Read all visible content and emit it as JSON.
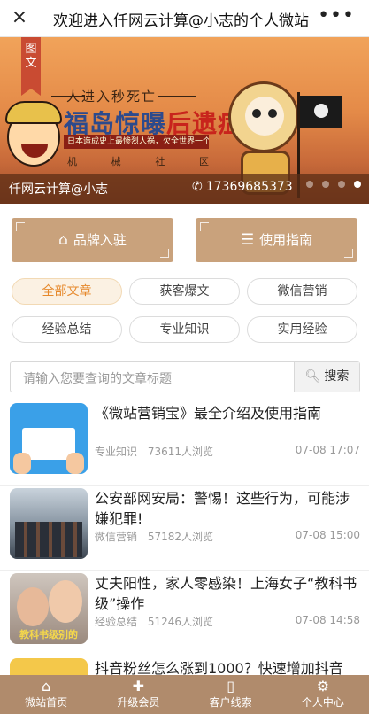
{
  "topbar": {
    "title": "欢迎进入仟网云计算@小志的个人微站",
    "close_icon": "×",
    "more_icon": "•••"
  },
  "banner": {
    "tag": "图文",
    "kicker": "人进入秒死亡",
    "headline_blue": "福岛惊曝",
    "headline_red": "后遗症",
    "strip": "日本造成史上最惨烈人祸，欠全世界一个交代!",
    "chars": [
      "机",
      "械",
      "社",
      "区"
    ],
    "site_name": "仟网云计算@小志",
    "phone": "17369685373",
    "carousel_active_index": 3,
    "carousel_count": 4
  },
  "actions": {
    "brand_label": "品牌入驻",
    "guide_label": "使用指南"
  },
  "categories": [
    "全部文章",
    "获客爆文",
    "微信营销",
    "经验总结",
    "专业知识",
    "实用经验"
  ],
  "search": {
    "placeholder": "请输入您要查询的文章标题",
    "button_label": "搜索"
  },
  "articles": [
    {
      "title": "《微站营销宝》最全介绍及使用指南",
      "category": "专业知识",
      "views": "73611人浏览",
      "time": "07-08 17:07",
      "thumb_text": ""
    },
    {
      "title": "公安部网安局：警惕！这些行为，可能涉嫌犯罪!",
      "category": "微信营销",
      "views": "57182人浏览",
      "time": "07-08 15:00",
      "thumb_text": ""
    },
    {
      "title": "丈夫阳性，家人零感染！上海女子“教科书级”操作",
      "category": "经验总结",
      "views": "51246人浏览",
      "time": "07-08 14:58",
      "thumb_text": "教科书级别的"
    },
    {
      "title": "抖音粉丝怎么涨到1000？快速增加抖音",
      "category": "",
      "views": "",
      "time": "",
      "thumb_text": ""
    }
  ],
  "bottomnav": [
    {
      "label": "微站首页",
      "icon": "home-icon"
    },
    {
      "label": "升级会员",
      "icon": "gift-icon"
    },
    {
      "label": "客户线索",
      "icon": "phone-icon"
    },
    {
      "label": "个人中心",
      "icon": "gear-icon"
    }
  ],
  "colors": {
    "accent_brown": "#c9a27c",
    "nav_brown": "#b08b6c",
    "active_orange": "#e6892c"
  }
}
